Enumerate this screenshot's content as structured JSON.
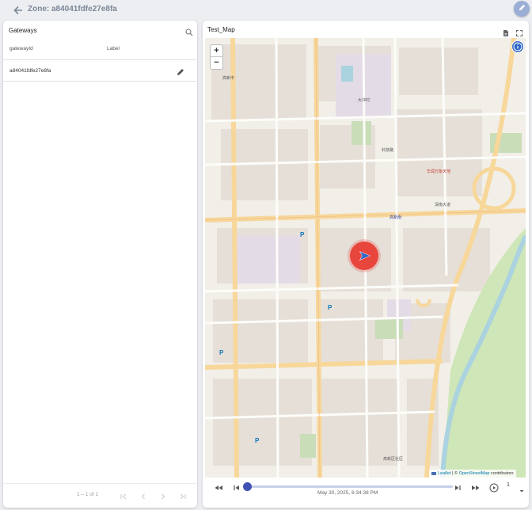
{
  "header": {
    "title": "Zone: a84041fdfe27e8fa",
    "back_icon": "arrow-left-icon",
    "edit_icon": "pencil-icon"
  },
  "gateways": {
    "title": "Gateways",
    "columns": [
      "gatewayId",
      "Label"
    ],
    "rows": [
      {
        "gatewayId": "a84041fdfe27e8fa",
        "label": ""
      }
    ],
    "pagination": "1 – 1 of 1"
  },
  "map": {
    "title": "Test_Map",
    "zoom_in": "+",
    "zoom_out": "−",
    "attribution_leaflet": "Leaflet",
    "attribution_sep": " | © ",
    "attribution_osm": "OpenStreetMap",
    "attribution_tail": " contributors",
    "labels": {
      "l1": "高新中",
      "l2": "大冲村",
      "l3": "科技路",
      "l4": "高新南",
      "l5": "华润万象天地",
      "l6": "高新区社区",
      "l7": "深南大道"
    }
  },
  "playback": {
    "timestamp": "May 30, 2025, 6:34:38 PM",
    "speed": "1",
    "progress": 0.0
  },
  "colors": {
    "accent": "#3f51b5",
    "marker": "#e8453c",
    "fab": "#9aaed6",
    "info": "#2f66c8"
  }
}
